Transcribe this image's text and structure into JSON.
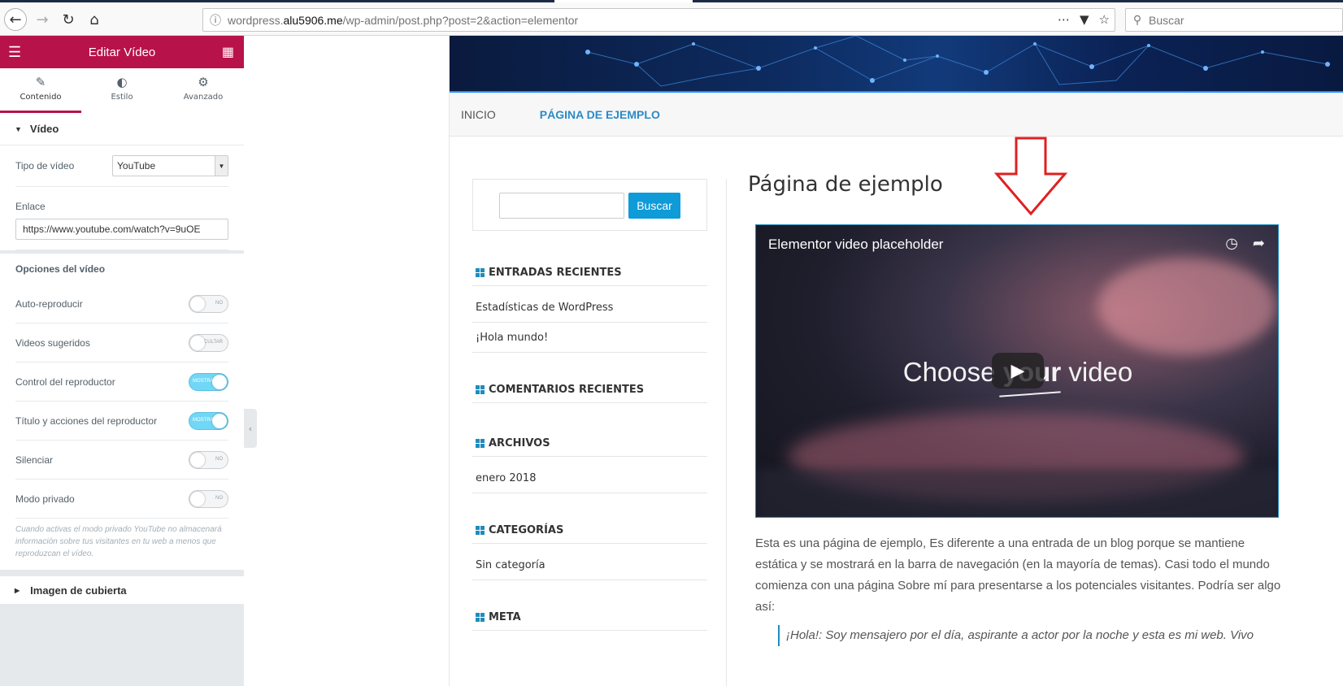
{
  "browser": {
    "url_prefix": "wordpress.",
    "url_host": "alu5906.me",
    "url_path": "/wp-admin/post.php?post=2&action=elementor",
    "search_placeholder": "Buscar"
  },
  "panel": {
    "title": "Editar Vídeo",
    "tabs": [
      {
        "label": "Contenido"
      },
      {
        "label": "Estilo"
      },
      {
        "label": "Avanzado"
      }
    ],
    "section_video": "Vídeo",
    "video_type_label": "Tipo de vídeo",
    "video_type_value": "YouTube",
    "link_label": "Enlace",
    "link_value": "https://www.youtube.com/watch?v=9uOE",
    "options_label": "Opciones del vídeo",
    "toggles": [
      {
        "label": "Auto-reproducir",
        "state": "NO",
        "on": false
      },
      {
        "label": "Videos sugeridos",
        "state": "OCULTAR",
        "on": false
      },
      {
        "label": "Control del reproductor",
        "state": "MOSTRA",
        "on": true
      },
      {
        "label": "Título y acciones del reproductor",
        "state": "MOSTRA",
        "on": true
      },
      {
        "label": "Silenciar",
        "state": "NO",
        "on": false
      },
      {
        "label": "Modo privado",
        "state": "NO",
        "on": false
      }
    ],
    "privacy_note": "Cuando activas el modo privado YouTube no almacenará información sobre tus visitantes en tu web a menos que reproduzcan el vídeo.",
    "cover_section": "Imagen de cubierta"
  },
  "site": {
    "nav": [
      "INICIO",
      "PÁGINA DE EJEMPLO"
    ],
    "search_button": "Buscar",
    "widgets": {
      "recent_posts_title": "ENTRADAS RECIENTES",
      "recent_posts": [
        "Estadísticas de WordPress",
        "¡Hola mundo!"
      ],
      "recent_comments_title": "COMENTARIOS RECIENTES",
      "archives_title": "ARCHIVOS",
      "archives": [
        "enero 2018"
      ],
      "categories_title": "CATEGORÍAS",
      "categories": [
        "Sin categoría"
      ],
      "meta_title": "META"
    },
    "page_title": "Página de ejemplo",
    "video": {
      "title": "Elementor video placeholder",
      "choose_left": "Choose ",
      "choose_mid": "your",
      "choose_right": " video"
    },
    "paragraph": "Esta es una página de ejemplo, Es diferente a una entrada de un blog porque se mantiene estática y se mostrará en la barra de navegación (en la mayoría de temas). Casi todo el mundo comienza con una página Sobre mí para presentarse a los potenciales visitantes. Podría ser algo así:",
    "quote": "¡Hola!: Soy mensajero por el día, aspirante a actor por la noche y esta es mi web. Vivo"
  },
  "colors": {
    "elementor_accent": "#b8124a",
    "site_accent": "#1e8cbe",
    "arrow": "#e02020"
  }
}
